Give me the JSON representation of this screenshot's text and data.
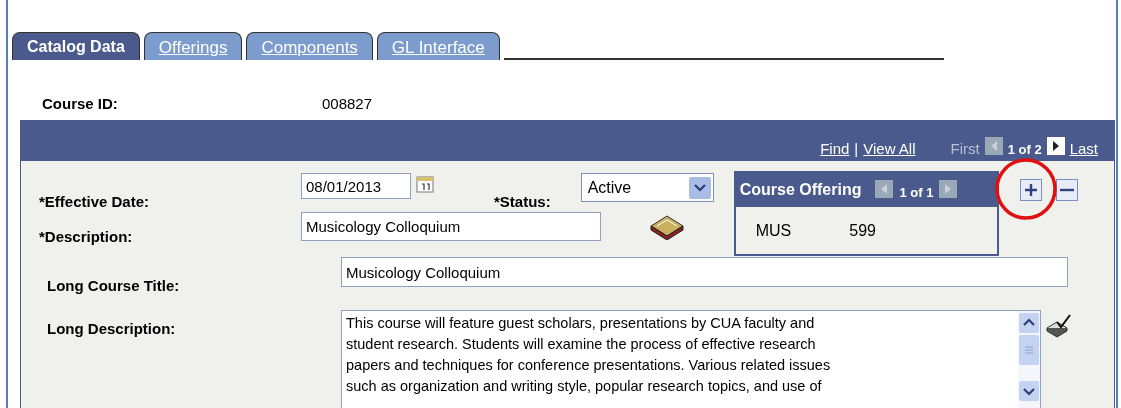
{
  "tabs": [
    {
      "label": "Catalog Data",
      "selected": true
    },
    {
      "label": "Offerings",
      "selected": false
    },
    {
      "label": "Components",
      "selected": false
    },
    {
      "label": "GL Interface",
      "selected": false
    }
  ],
  "course_id": {
    "label": "Course ID:",
    "value": "008827"
  },
  "navigation": {
    "find": "Find",
    "separator": "|",
    "view_all": "View All",
    "first": "First",
    "position": "1 of 2",
    "last": "Last"
  },
  "effective_date": {
    "label": "*Effective Date:",
    "value": "08/01/2013"
  },
  "status": {
    "label": "*Status:",
    "value": "Active"
  },
  "course_offering": {
    "title": "Course Offering",
    "position": "1 of 1",
    "subject": "MUS",
    "catalog_number": "599"
  },
  "description": {
    "label": "*Description:",
    "value": "Musicology Colloquium"
  },
  "long_course_title": {
    "label": "Long Course Title:",
    "value": "Musicology Colloquium"
  },
  "long_description": {
    "label": "Long Description:",
    "value": "This course will feature guest scholars, presentations by CUA faculty and\nstudent research. Students will examine the process of effective research\npapers and techniques for conference presentations. Various related issues\nsuch as organization and writing style, popular research topics, and use of"
  }
}
